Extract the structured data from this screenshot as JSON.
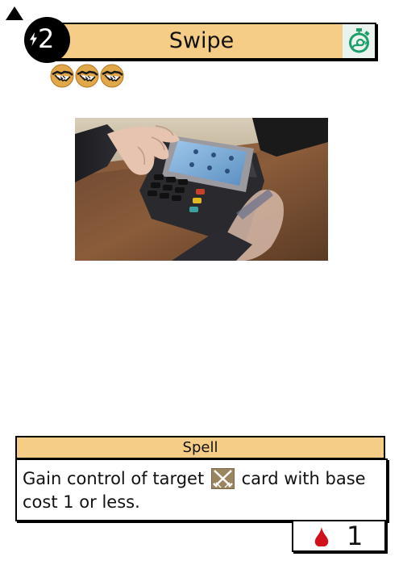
{
  "card": {
    "name": "Swipe",
    "cost": "2",
    "type_line": "Spell",
    "rules_text": {
      "before_icon": "Gain control of target",
      "icon": "crossed-swords-icon",
      "after_icon": "card with base cost 1 or less."
    },
    "stat_value": "1",
    "stat_icon": "blood-drop-icon",
    "timing_icon": "stopwatch-snail-icon",
    "token_icons": [
      "handshake-icon",
      "handshake-icon",
      "handshake-icon"
    ]
  },
  "colors": {
    "title_bar": "#f5cd87",
    "cost_circle": "#000000",
    "blood": "#d0101a",
    "timing_icon": "#1f9e6a",
    "token_bg": "#e0a848"
  }
}
